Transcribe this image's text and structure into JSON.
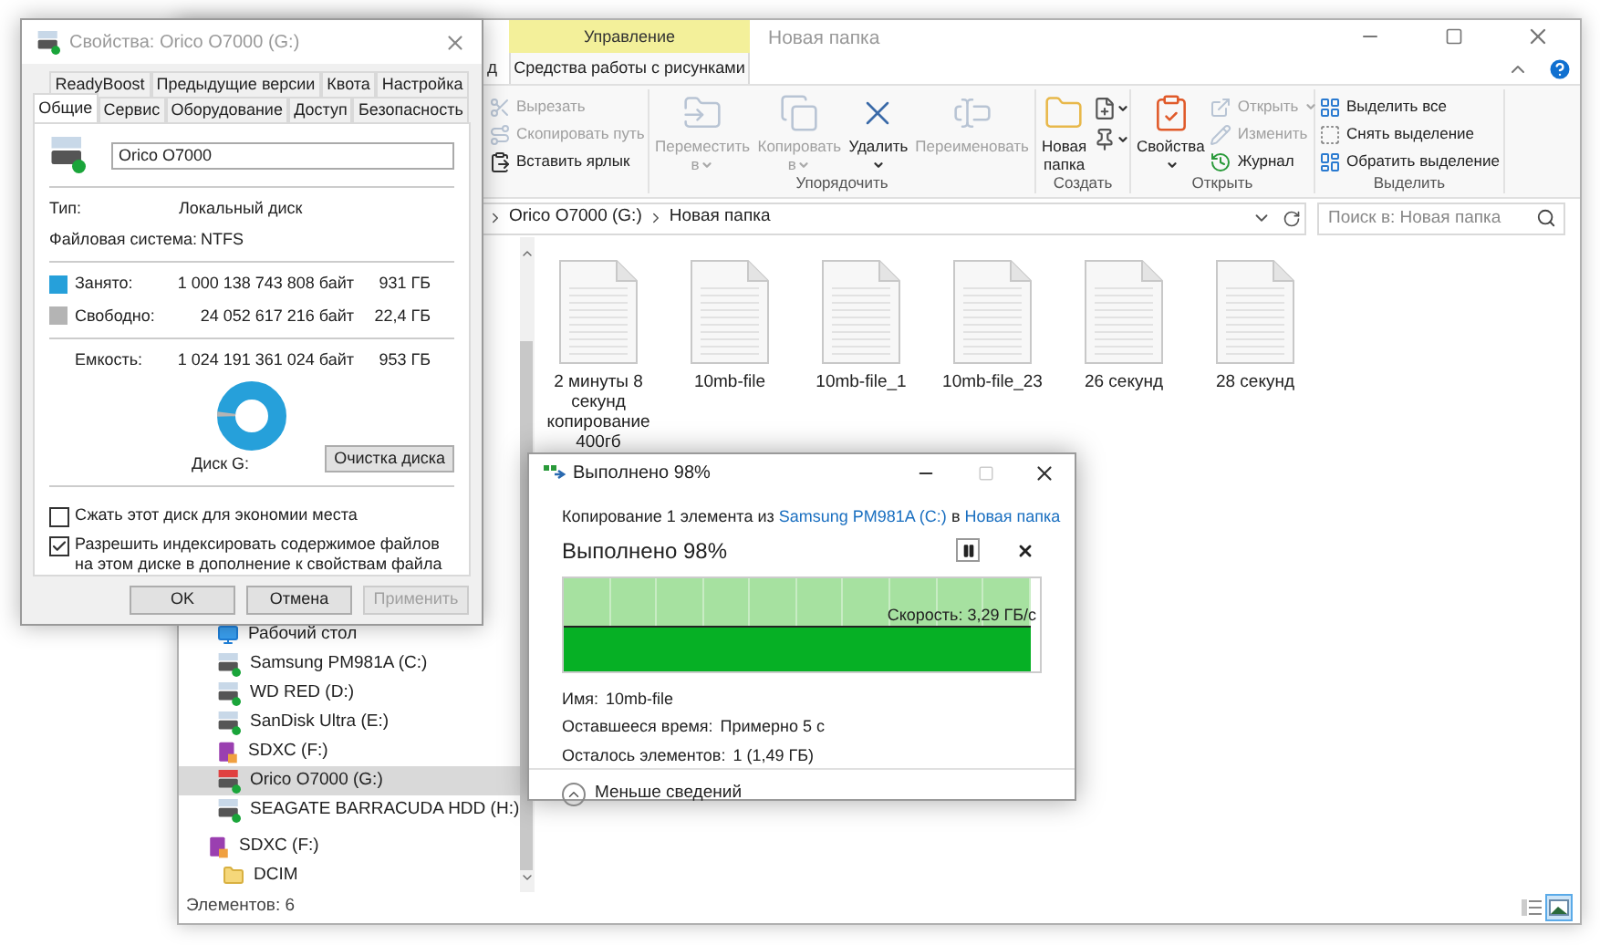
{
  "explorer": {
    "title": "Новая папка",
    "partial_tab": "д",
    "context_tab": {
      "group": "Управление",
      "label": "Средства работы с рисунками",
      "selected": true
    },
    "ribbon_groups": [
      {
        "items": [
          {
            "kind": "small",
            "label": "Вырезать",
            "disabled": true,
            "dropdown": false
          },
          {
            "kind": "small",
            "label": "Скопировать путь",
            "disabled": true,
            "dropdown": false
          },
          {
            "kind": "small",
            "label": "Вставить ярлык",
            "disabled": false,
            "dropdown": false
          }
        ]
      },
      {
        "label": "Упорядочить",
        "items": [
          {
            "kind": "large",
            "label": "Переместить в",
            "disabled": true,
            "dropdown": true
          },
          {
            "kind": "large",
            "label": "Копировать в",
            "disabled": true,
            "dropdown": true
          },
          {
            "kind": "large",
            "label": "Удалить",
            "disabled": false,
            "dropdown": true
          },
          {
            "kind": "large",
            "label": "Переименовать",
            "disabled": true,
            "dropdown": false
          }
        ]
      },
      {
        "label": "Создать",
        "items": [
          {
            "kind": "large",
            "label": "Новая папка",
            "disabled": false,
            "dropdown": false
          },
          {
            "kind": "icon",
            "disabled": false,
            "dropdown": true
          },
          {
            "kind": "icon",
            "disabled": false,
            "dropdown": true
          }
        ]
      },
      {
        "label": "Открыть",
        "items": [
          {
            "kind": "large",
            "label": "Свойства",
            "disabled": false,
            "dropdown": true
          },
          {
            "kind": "small",
            "label": "Открыть",
            "disabled": true,
            "dropdown": true
          },
          {
            "kind": "small",
            "label": "Изменить",
            "disabled": true,
            "dropdown": false
          },
          {
            "kind": "small",
            "label": "Журнал",
            "disabled": false,
            "dropdown": false
          }
        ]
      },
      {
        "label": "Выделить",
        "items": [
          {
            "kind": "small",
            "label": "Выделить все",
            "disabled": false,
            "dropdown": false
          },
          {
            "kind": "small",
            "label": "Снять выделение",
            "disabled": false,
            "dropdown": false
          },
          {
            "kind": "small",
            "label": "Обратить выделение",
            "disabled": false,
            "dropdown": false
          }
        ]
      }
    ],
    "breadcrumb": [
      "Orico O7000 (G:)",
      "Новая папка"
    ],
    "search": {
      "placeholder": "Поиск в: Новая папка"
    },
    "nav": {
      "drives": [
        {
          "kind": "desktop",
          "label": "Рабочий стол",
          "selected": false
        },
        {
          "kind": "drive",
          "label": "Samsung PM981A (C:)",
          "selected": false,
          "low_space": false
        },
        {
          "kind": "drive",
          "label": "WD RED (D:)",
          "selected": false,
          "low_space": false
        },
        {
          "kind": "drive",
          "label": "SanDisk Ultra (E:)",
          "selected": false,
          "low_space": false
        },
        {
          "kind": "sd",
          "label": "SDXC (F:)",
          "selected": false
        },
        {
          "kind": "drive",
          "label": "Orico O7000 (G:)",
          "selected": true,
          "low_space": true
        },
        {
          "kind": "drive",
          "label": "SEAGATE BARRACUDA HDD (H:)",
          "selected": false,
          "low_space": false
        }
      ],
      "items": [
        {
          "kind": "sd",
          "label": "SDXC (F:)",
          "selected": false,
          "children": [
            {
              "kind": "folder",
              "label": "DCIM",
              "selected": false
            }
          ]
        }
      ]
    },
    "files": [
      "2 минуты 8 секунд копирование 400гб",
      "10mb-file",
      "10mb-file_1",
      "10mb-file_23",
      "26 секунд",
      "28 секунд"
    ],
    "status": "Элементов: 6",
    "views": [
      {
        "kind": "details",
        "selected": false
      },
      {
        "kind": "large_icons",
        "selected": true
      }
    ]
  },
  "properties_dialog": {
    "title": "Свойства: Orico O7000 (G:)",
    "tabs_back": [
      {
        "label": "ReadyBoost",
        "selected": false
      },
      {
        "label": "Предыдущие версии",
        "selected": false
      },
      {
        "label": "Квота",
        "selected": false
      },
      {
        "label": "Настройка",
        "selected": false
      }
    ],
    "tabs_front": [
      {
        "label": "Общие",
        "selected": true
      },
      {
        "label": "Сервис",
        "selected": false
      },
      {
        "label": "Оборудование",
        "selected": false
      },
      {
        "label": "Доступ",
        "selected": false
      },
      {
        "label": "Безопасность",
        "selected": false
      }
    ],
    "name_value": "Orico O7000",
    "info": [
      {
        "label": "Тип:",
        "value": "Локальный диск"
      },
      {
        "label": "Файловая система:",
        "value": "NTFS"
      }
    ],
    "space": [
      {
        "label": "Занято:",
        "bytes": "1 000 138 743 808 байт",
        "size": "931 ГБ",
        "color": "#26a0da"
      },
      {
        "label": "Свободно:",
        "bytes": "24 052 617 216 байт",
        "size": "22,4 ГБ",
        "color": "#b4b4b4"
      }
    ],
    "capacity": {
      "label": "Емкость:",
      "bytes": "1 024 191 361 024 байт",
      "size": "953 ГБ"
    },
    "disk_label": "Диск G:",
    "cleanup_button": "Очистка диска",
    "options": [
      {
        "label": "Сжать этот диск для экономии места",
        "checked": false
      },
      {
        "label": "Разрешить индексировать содержимое файлов на этом диске в дополнение к свойствам файла",
        "checked": true
      }
    ],
    "buttons": [
      {
        "label": "OK",
        "disabled": false
      },
      {
        "label": "Отмена",
        "disabled": false
      },
      {
        "label": "Применить",
        "disabled": true
      }
    ]
  },
  "copy_dialog": {
    "title": "Выполнено 98%",
    "source_prefix": "Копирование 1 элемента из",
    "source": "Samsung PM981A (C:)",
    "joiner": "в",
    "target": "Новая папка",
    "heading": "Выполнено 98%",
    "progress": {
      "level": 0.98,
      "speed": "Скорость: 3,29 ГБ/с"
    },
    "details": [
      {
        "label": "Имя:",
        "value": "10mb-file"
      },
      {
        "label": "Оставшееся время:",
        "value": "Примерно 5 с"
      },
      {
        "label": "Осталось элементов:",
        "value": "1 (1,49 ГБ)"
      }
    ],
    "toggle": "Меньше сведений"
  }
}
